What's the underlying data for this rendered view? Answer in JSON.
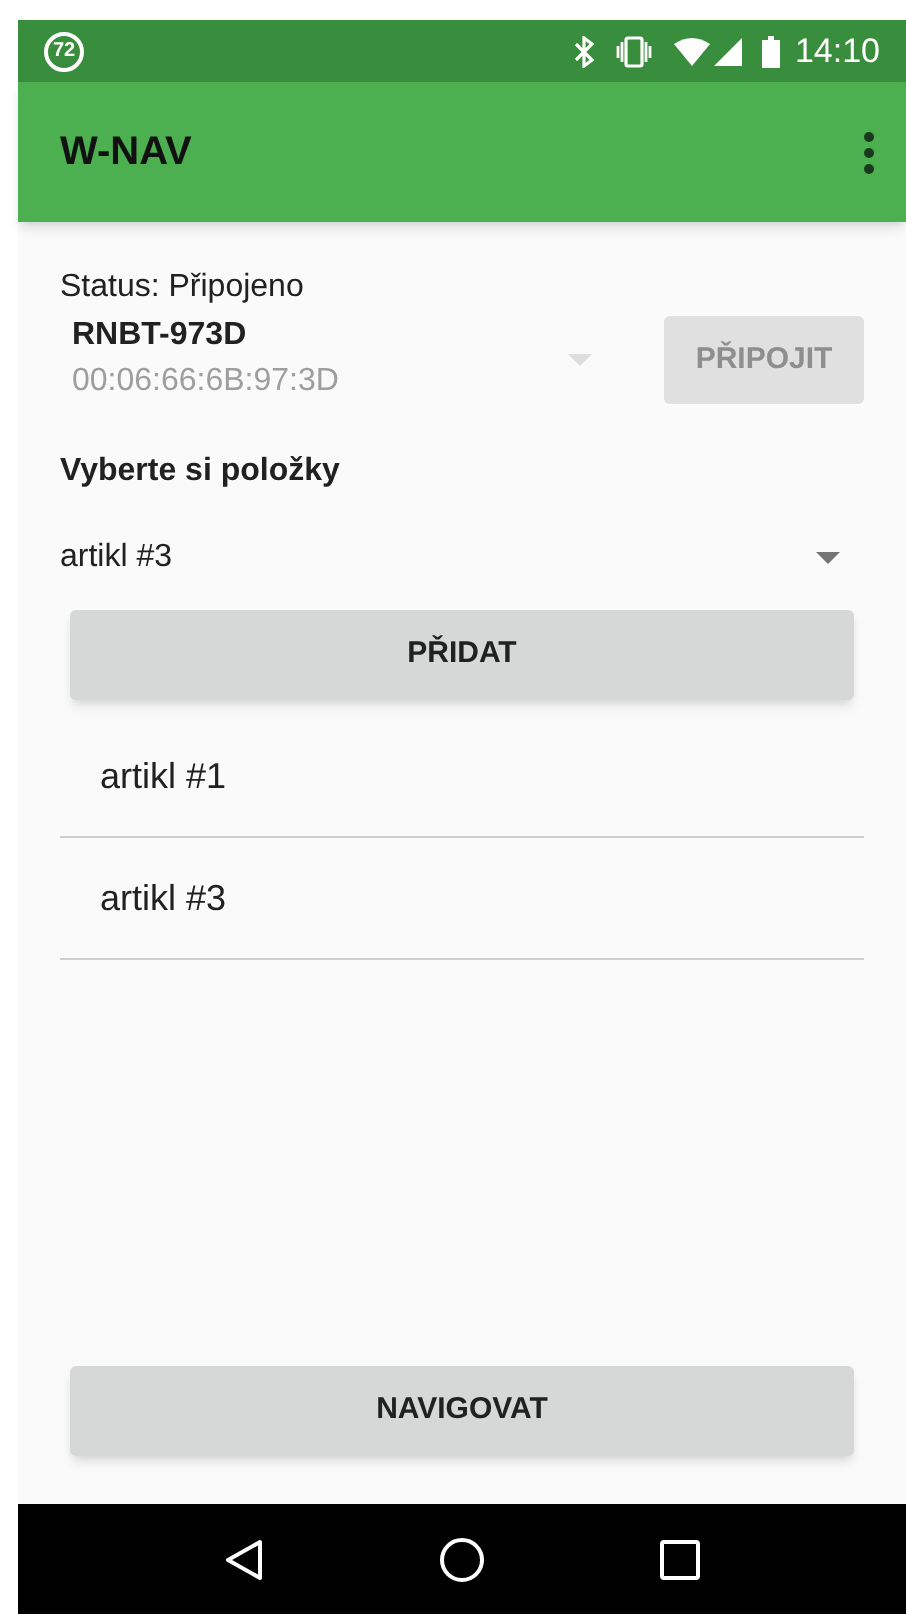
{
  "status_bar": {
    "notification": "72",
    "time": "14:10"
  },
  "app_bar": {
    "title": "W-NAV"
  },
  "status": "Status: Připojeno",
  "device": {
    "name": "RNBT-973D",
    "address": "00:06:66:6B:97:3D"
  },
  "connect_button": {
    "label": "PŘIPOJIT",
    "disabled": true
  },
  "items_label": "Vyberte si položky",
  "item_select": {
    "value": "artikl #3"
  },
  "add_button": {
    "label": "PŘIDAT"
  },
  "items": [
    "artikl #1",
    "artikl #3"
  ],
  "navigate_button": {
    "label": "NAVIGOVAT"
  }
}
